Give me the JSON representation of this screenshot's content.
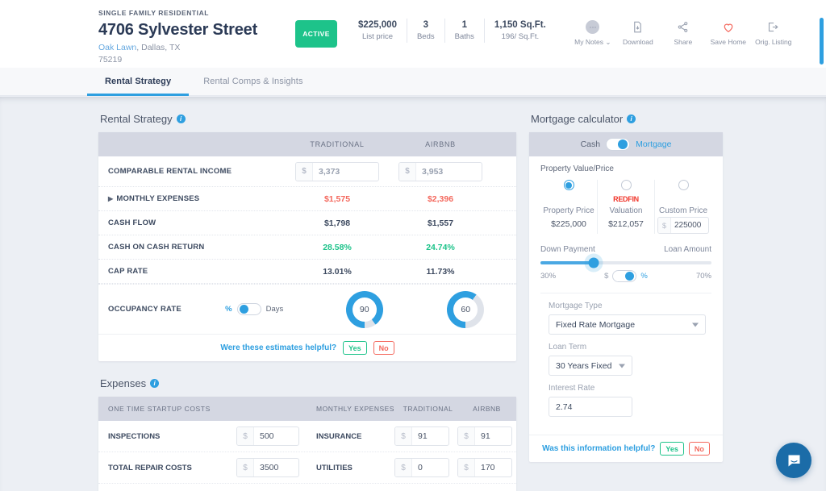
{
  "header": {
    "property_type": "SINGLE FAMILY RESIDENTIAL",
    "address": "4706 Sylvester Street",
    "neighborhood": "Oak Lawn",
    "city_state": ", Dallas, TX",
    "zip": "75219",
    "status": "ACTIVE",
    "stats": [
      {
        "value": "$225,000",
        "label": "List price"
      },
      {
        "value": "3",
        "label": "Beds"
      },
      {
        "value": "1",
        "label": "Baths"
      },
      {
        "value": "1,150 Sq.Ft.",
        "label": "196/ Sq.Ft."
      }
    ],
    "actions": [
      {
        "icon": "avatar-icon",
        "label": "My Notes ⌄"
      },
      {
        "icon": "download-icon",
        "label": "Download"
      },
      {
        "icon": "share-icon",
        "label": "Share"
      },
      {
        "icon": "heart-icon",
        "label": "Save Home"
      },
      {
        "icon": "external-link-icon",
        "label": "Orig. Listing"
      }
    ]
  },
  "tabs": [
    {
      "label": "Rental Strategy",
      "active": true
    },
    {
      "label": "Rental Comps & Insights",
      "active": false
    }
  ],
  "rental_strategy": {
    "title": "Rental Strategy",
    "columns": [
      "TRADITIONAL",
      "AIRBNB"
    ],
    "rows": [
      {
        "label": "COMPARABLE RENTAL INCOME",
        "type": "input",
        "traditional": "3,373",
        "airbnb": "3,953",
        "prefix": "$"
      },
      {
        "label": "MONTHLY EXPENSES",
        "type": "expandable",
        "traditional": "$1,575",
        "airbnb": "$2,396",
        "style": "neg"
      },
      {
        "label": "CASH FLOW",
        "type": "text",
        "traditional": "$1,798",
        "airbnb": "$1,557",
        "style": "plain"
      },
      {
        "label": "CASH ON CASH RETURN",
        "type": "text",
        "traditional": "28.58%",
        "airbnb": "24.74%",
        "style": "pos"
      },
      {
        "label": "CAP RATE",
        "type": "text",
        "traditional": "13.01%",
        "airbnb": "11.73%",
        "style": "plain"
      }
    ],
    "occupancy": {
      "label": "OCCUPANCY RATE",
      "unit_left": "%",
      "unit_right": "Days",
      "selected_unit": "%",
      "traditional_value": "90",
      "airbnb_value": "60"
    },
    "helpful": {
      "question": "Were these estimates helpful?",
      "yes": "Yes",
      "no": "No"
    }
  },
  "expenses": {
    "title": "Expenses",
    "col_startup": "ONE TIME STARTUP COSTS",
    "col_monthly": "MONTHLY EXPENSES",
    "col_traditional": "TRADITIONAL",
    "col_airbnb": "AIRBNB",
    "rows": [
      {
        "startup_label": "INSPECTIONS",
        "startup_value": "500",
        "monthly_label": "INSURANCE",
        "traditional": "91",
        "airbnb": "91"
      },
      {
        "startup_label": "TOTAL REPAIR COSTS",
        "startup_value": "3500",
        "monthly_label": "UTILITIES",
        "traditional": "0",
        "airbnb": "170"
      }
    ],
    "prefix": "$"
  },
  "mortgage": {
    "title": "Mortgage calculator",
    "mode_left": "Cash",
    "mode_right": "Mortgage",
    "mode_selected": "Mortgage",
    "property_value_label": "Property Value/Price",
    "price_options": [
      {
        "name": "Property Price",
        "value": "$225,000",
        "selected": true,
        "logo": ""
      },
      {
        "name": "Valuation",
        "value": "$212,057",
        "selected": false,
        "logo": "REDFIN"
      },
      {
        "name": "Custom Price",
        "value": "225000",
        "selected": false,
        "logo": "",
        "input": true,
        "prefix": "$"
      }
    ],
    "down_payment_label": "Down Payment",
    "loan_amount_label": "Loan Amount",
    "down_payment_pct": "30%",
    "loan_amount_pct": "70%",
    "unit_dollar": "$",
    "unit_percent": "%",
    "unit_selected": "%",
    "mortgage_type_label": "Mortgage Type",
    "mortgage_type_value": "Fixed Rate Mortgage",
    "loan_term_label": "Loan Term",
    "loan_term_value": "30 Years Fixed",
    "interest_rate_label": "Interest Rate",
    "interest_rate_value": "2.74",
    "helpful": {
      "question": "Was this information helpful?",
      "yes": "Yes",
      "no": "No"
    }
  },
  "chat": {
    "icon": "chat-bubble-icon"
  },
  "colors": {
    "accent_blue": "#2e9fe0",
    "green": "#1dc38a",
    "red": "#f4685d",
    "header_gray": "#d4d7e2",
    "redfin_red": "#f0352a"
  }
}
